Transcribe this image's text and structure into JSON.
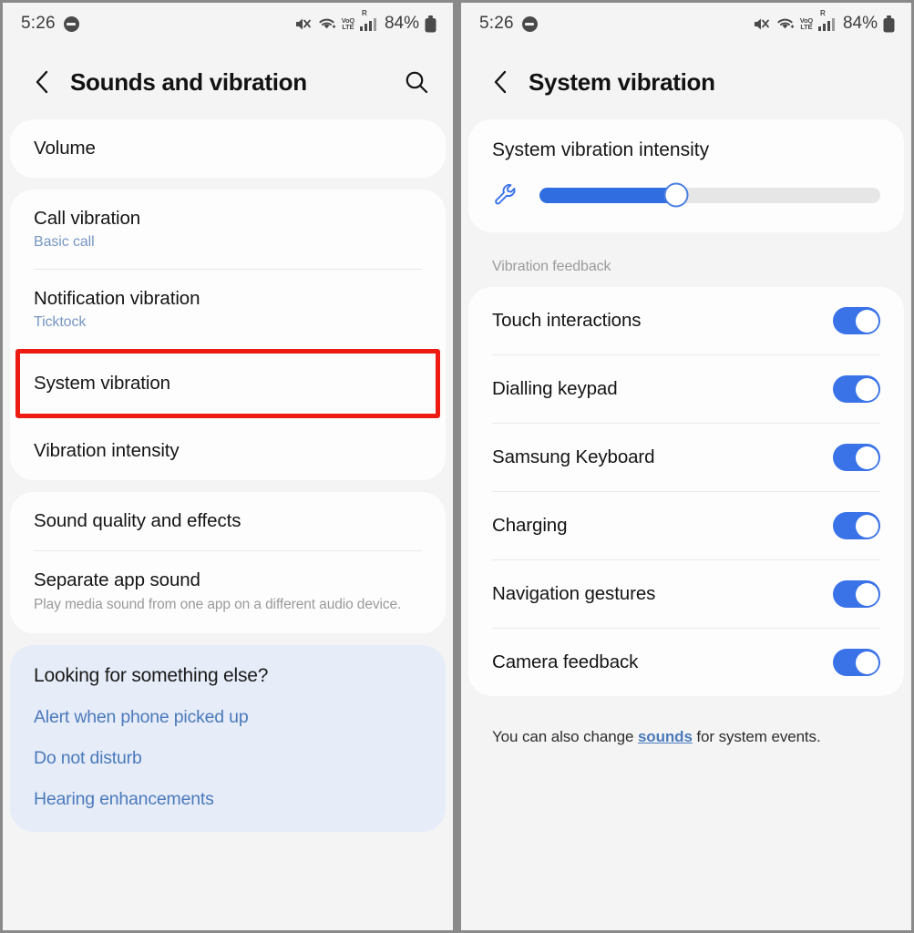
{
  "left": {
    "status": {
      "time": "5:26",
      "dnd_icon": "do-not-disturb-icon",
      "mute_icon": "sound-mute-icon",
      "wifi_icon": "wifi-icon",
      "volte_top": "VoLTE",
      "volte_line1": "VoQ",
      "volte_line2": "LTE",
      "roaming": "R",
      "signal_icon": "signal-bars-icon",
      "battery_percent": "84%",
      "battery_icon": "battery-icon"
    },
    "appbar": {
      "back_icon": "back-chevron-icon",
      "title": "Sounds and vibration",
      "search_icon": "search-icon"
    },
    "card1": [
      {
        "title": "Volume"
      }
    ],
    "card2": [
      {
        "title": "Call vibration",
        "sub": "Basic call"
      },
      {
        "title": "Notification vibration",
        "sub": "Ticktock"
      },
      {
        "title": "System vibration",
        "highlighted": true
      },
      {
        "title": "Vibration intensity"
      }
    ],
    "card3": [
      {
        "title": "Sound quality and effects"
      },
      {
        "title": "Separate app sound",
        "desc": "Play media sound from one app on a different audio device."
      }
    ],
    "suggest": {
      "heading": "Looking for something else?",
      "links": [
        "Alert when phone picked up",
        "Do not disturb",
        "Hearing enhancements"
      ]
    },
    "highlight_color": "#ee1b13"
  },
  "right": {
    "status": {
      "time": "5:26",
      "battery_percent": "84%",
      "volte_line1": "VoQ",
      "volte_line2": "LTE",
      "roaming": "R"
    },
    "appbar": {
      "back_icon": "back-chevron-icon",
      "title": "System vibration"
    },
    "intensity": {
      "title": "System vibration intensity",
      "wrench_icon": "wrench-icon",
      "value_percent": 40,
      "fill_color": "#2f6de0"
    },
    "section_label": "Vibration feedback",
    "toggles": [
      {
        "label": "Touch interactions",
        "on": true
      },
      {
        "label": "Dialling keypad",
        "on": true
      },
      {
        "label": "Samsung Keyboard",
        "on": true
      },
      {
        "label": "Charging",
        "on": true
      },
      {
        "label": "Navigation gestures",
        "on": true
      },
      {
        "label": "Camera feedback",
        "on": true
      }
    ],
    "footnote": {
      "before": "You can also change ",
      "link": "sounds",
      "after": " for system events."
    },
    "accent_color": "#3a72e8"
  }
}
